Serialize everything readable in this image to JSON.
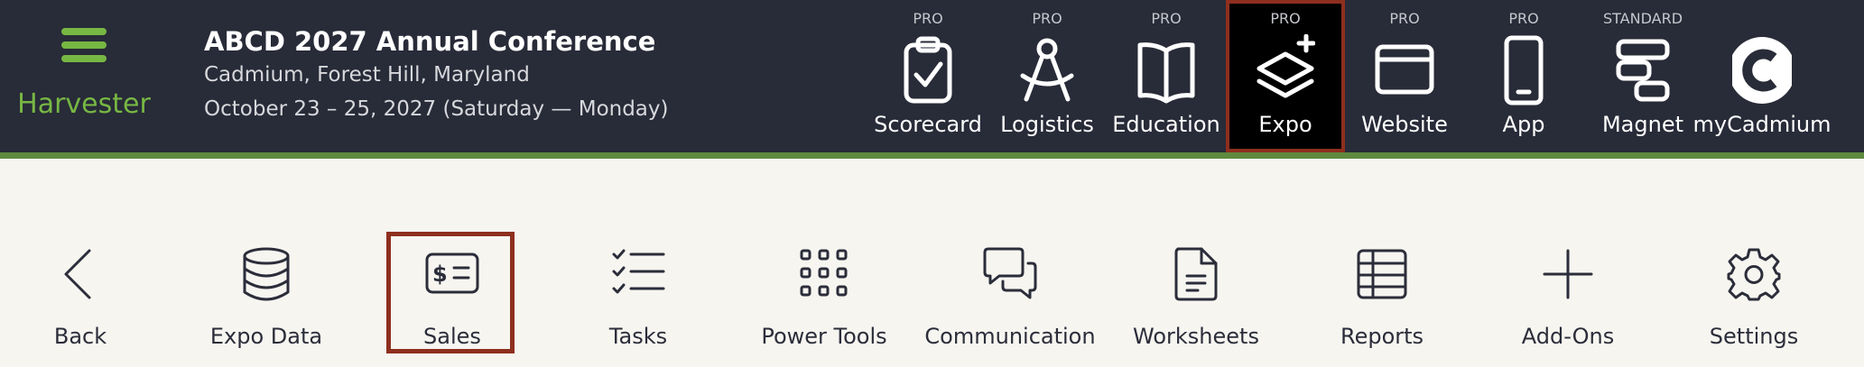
{
  "brand": {
    "app_name": "Harvester",
    "accent_color": "#77b743"
  },
  "event": {
    "title": "ABCD 2027 Annual Conference",
    "location": "Cadmium, Forest Hill, Maryland",
    "dates": "October 23 – 25, 2027 (Saturday — Monday)"
  },
  "products": [
    {
      "tier": "PRO",
      "label": "Scorecard",
      "icon": "clipboard-check-icon"
    },
    {
      "tier": "PRO",
      "label": "Logistics",
      "icon": "compass-icon"
    },
    {
      "tier": "PRO",
      "label": "Education",
      "icon": "open-book-icon"
    },
    {
      "tier": "PRO",
      "label": "Expo",
      "icon": "layers-plus-icon",
      "active": true
    },
    {
      "tier": "PRO",
      "label": "Website",
      "icon": "browser-window-icon"
    },
    {
      "tier": "PRO",
      "label": "App",
      "icon": "mobile-phone-icon"
    },
    {
      "tier": "STANDARD",
      "label": "Magnet",
      "icon": "flow-blocks-icon"
    },
    {
      "tier": "",
      "label": "myCadmium",
      "icon": "cadmium-logo-icon"
    }
  ],
  "toolbar": [
    {
      "label": "Back",
      "icon": "chevron-left-icon"
    },
    {
      "label": "Expo Data",
      "icon": "database-icon"
    },
    {
      "label": "Sales",
      "icon": "dollar-ticket-icon",
      "selected": true
    },
    {
      "label": "Tasks",
      "icon": "checklist-icon"
    },
    {
      "label": "Power Tools",
      "icon": "grid-dots-icon"
    },
    {
      "label": "Communication",
      "icon": "chat-bubbles-icon"
    },
    {
      "label": "Worksheets",
      "icon": "document-icon"
    },
    {
      "label": "Reports",
      "icon": "table-icon"
    },
    {
      "label": "Add-Ons",
      "icon": "plus-icon"
    },
    {
      "label": "Settings",
      "icon": "gear-icon"
    }
  ],
  "colors": {
    "header_bg": "#282b38",
    "accent_bar": "#5e8a3f",
    "selection_border": "#8e2f1e",
    "toolbar_bg": "#f6f5f0"
  }
}
